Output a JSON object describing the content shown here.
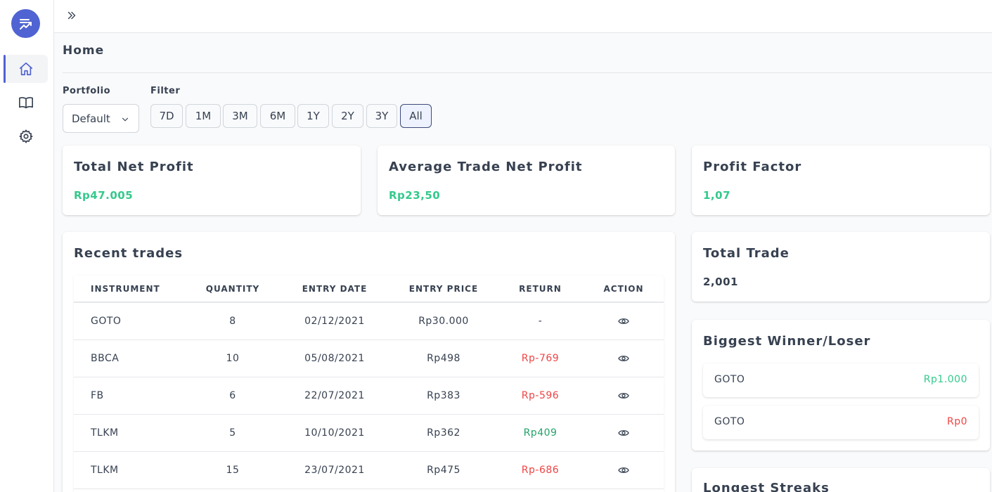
{
  "nav": {
    "items": [
      {
        "name": "home",
        "icon": "home-icon"
      },
      {
        "name": "journal",
        "icon": "book-icon"
      },
      {
        "name": "settings",
        "icon": "gear-icon"
      }
    ]
  },
  "page": {
    "title": "Home"
  },
  "controls": {
    "portfolio_label": "Portfolio",
    "portfolio_value": "Default",
    "filter_label": "Filter",
    "filters": [
      "7D",
      "1M",
      "3M",
      "6M",
      "1Y",
      "2Y",
      "3Y",
      "All"
    ],
    "active_filter": "All"
  },
  "stats": {
    "total_net_profit": {
      "title": "Total Net Profit",
      "value": "Rp47.005"
    },
    "avg_trade_net_profit": {
      "title": "Average Trade Net Profit",
      "value": "Rp23,50"
    },
    "profit_factor": {
      "title": "Profit Factor",
      "value": "1,07"
    },
    "total_trade": {
      "title": "Total Trade",
      "value": "2,001"
    }
  },
  "recent_trades": {
    "title": "Recent trades",
    "columns": [
      "INSTRUMENT",
      "QUANTITY",
      "ENTRY DATE",
      "ENTRY PRICE",
      "RETURN",
      "ACTION"
    ],
    "rows": [
      {
        "instrument": "GOTO",
        "quantity": "8",
        "entry_date": "02/12/2021",
        "entry_price": "Rp30.000",
        "return": "-",
        "return_status": "neutral"
      },
      {
        "instrument": "BBCA",
        "quantity": "10",
        "entry_date": "05/08/2021",
        "entry_price": "Rp498",
        "return": "Rp-769",
        "return_status": "loss"
      },
      {
        "instrument": "FB",
        "quantity": "6",
        "entry_date": "22/07/2021",
        "entry_price": "Rp383",
        "return": "Rp-596",
        "return_status": "loss"
      },
      {
        "instrument": "TLKM",
        "quantity": "5",
        "entry_date": "10/10/2021",
        "entry_price": "Rp362",
        "return": "Rp409",
        "return_status": "gain"
      },
      {
        "instrument": "TLKM",
        "quantity": "15",
        "entry_date": "23/07/2021",
        "entry_price": "Rp475",
        "return": "Rp-686",
        "return_status": "loss"
      }
    ]
  },
  "winner_loser": {
    "title": "Biggest Winner/Loser",
    "winner": {
      "symbol": "GOTO",
      "value": "Rp1.000"
    },
    "loser": {
      "symbol": "GOTO",
      "value": "Rp0"
    }
  },
  "streaks": {
    "title": "Longest Streaks"
  },
  "colors": {
    "accent": "#4f63d2",
    "gain": "#34c98c",
    "loss": "#ef4444"
  }
}
